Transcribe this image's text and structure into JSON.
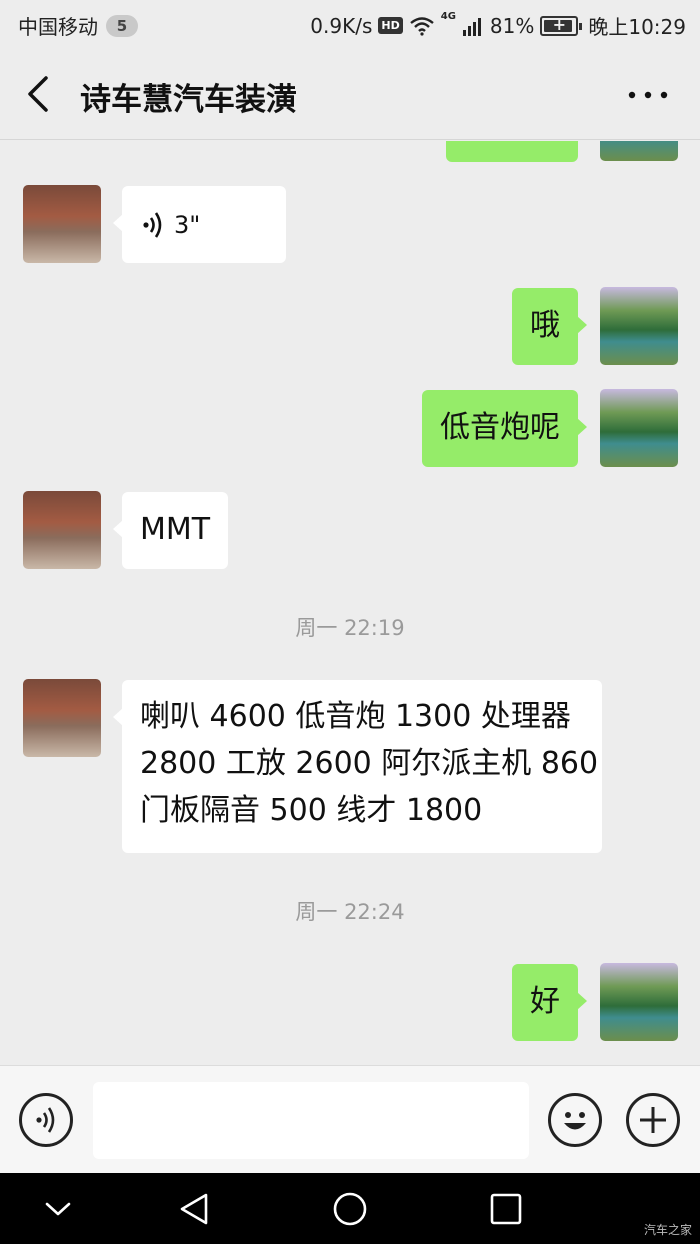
{
  "status_bar": {
    "carrier": "中国移动",
    "notification_count": "5",
    "speed": "0.9K/s",
    "hd": "HD",
    "network": "4G",
    "battery": "81%",
    "time": "晚上10:29"
  },
  "header": {
    "title": "诗车慧汽车装潢"
  },
  "messages": [
    {
      "side": "left",
      "type": "voice",
      "text": "3\""
    },
    {
      "side": "right",
      "type": "text",
      "text": "哦"
    },
    {
      "side": "right",
      "type": "text",
      "text": "低音炮呢"
    },
    {
      "side": "left",
      "type": "text",
      "text": "MMT"
    },
    {
      "type": "timestamp",
      "text": "周一 22:19"
    },
    {
      "side": "left",
      "type": "text",
      "lines": [
        "喇叭 4600 低音炮 1300 处理器",
        "2800 工放 2600 阿尔派主机 860",
        "门板隔音 500 线才 1800"
      ]
    },
    {
      "type": "timestamp",
      "text": "周一 22:24"
    },
    {
      "side": "right",
      "type": "text",
      "text": "好"
    }
  ],
  "input_bar": {
    "text_value": ""
  },
  "watermark": "汽车之家",
  "icons": {
    "back": "back-arrow-icon",
    "more": "more-icon",
    "voice": "voice-icon",
    "emoji": "emoji-icon",
    "plus": "plus-icon",
    "nav_down": "nav-down-icon",
    "nav_back": "nav-back-icon",
    "nav_home": "nav-home-icon",
    "nav_recent": "nav-recent-icon"
  },
  "colors": {
    "background": "#ededed",
    "bubble_self": "#95ec69",
    "bubble_other": "#ffffff"
  }
}
